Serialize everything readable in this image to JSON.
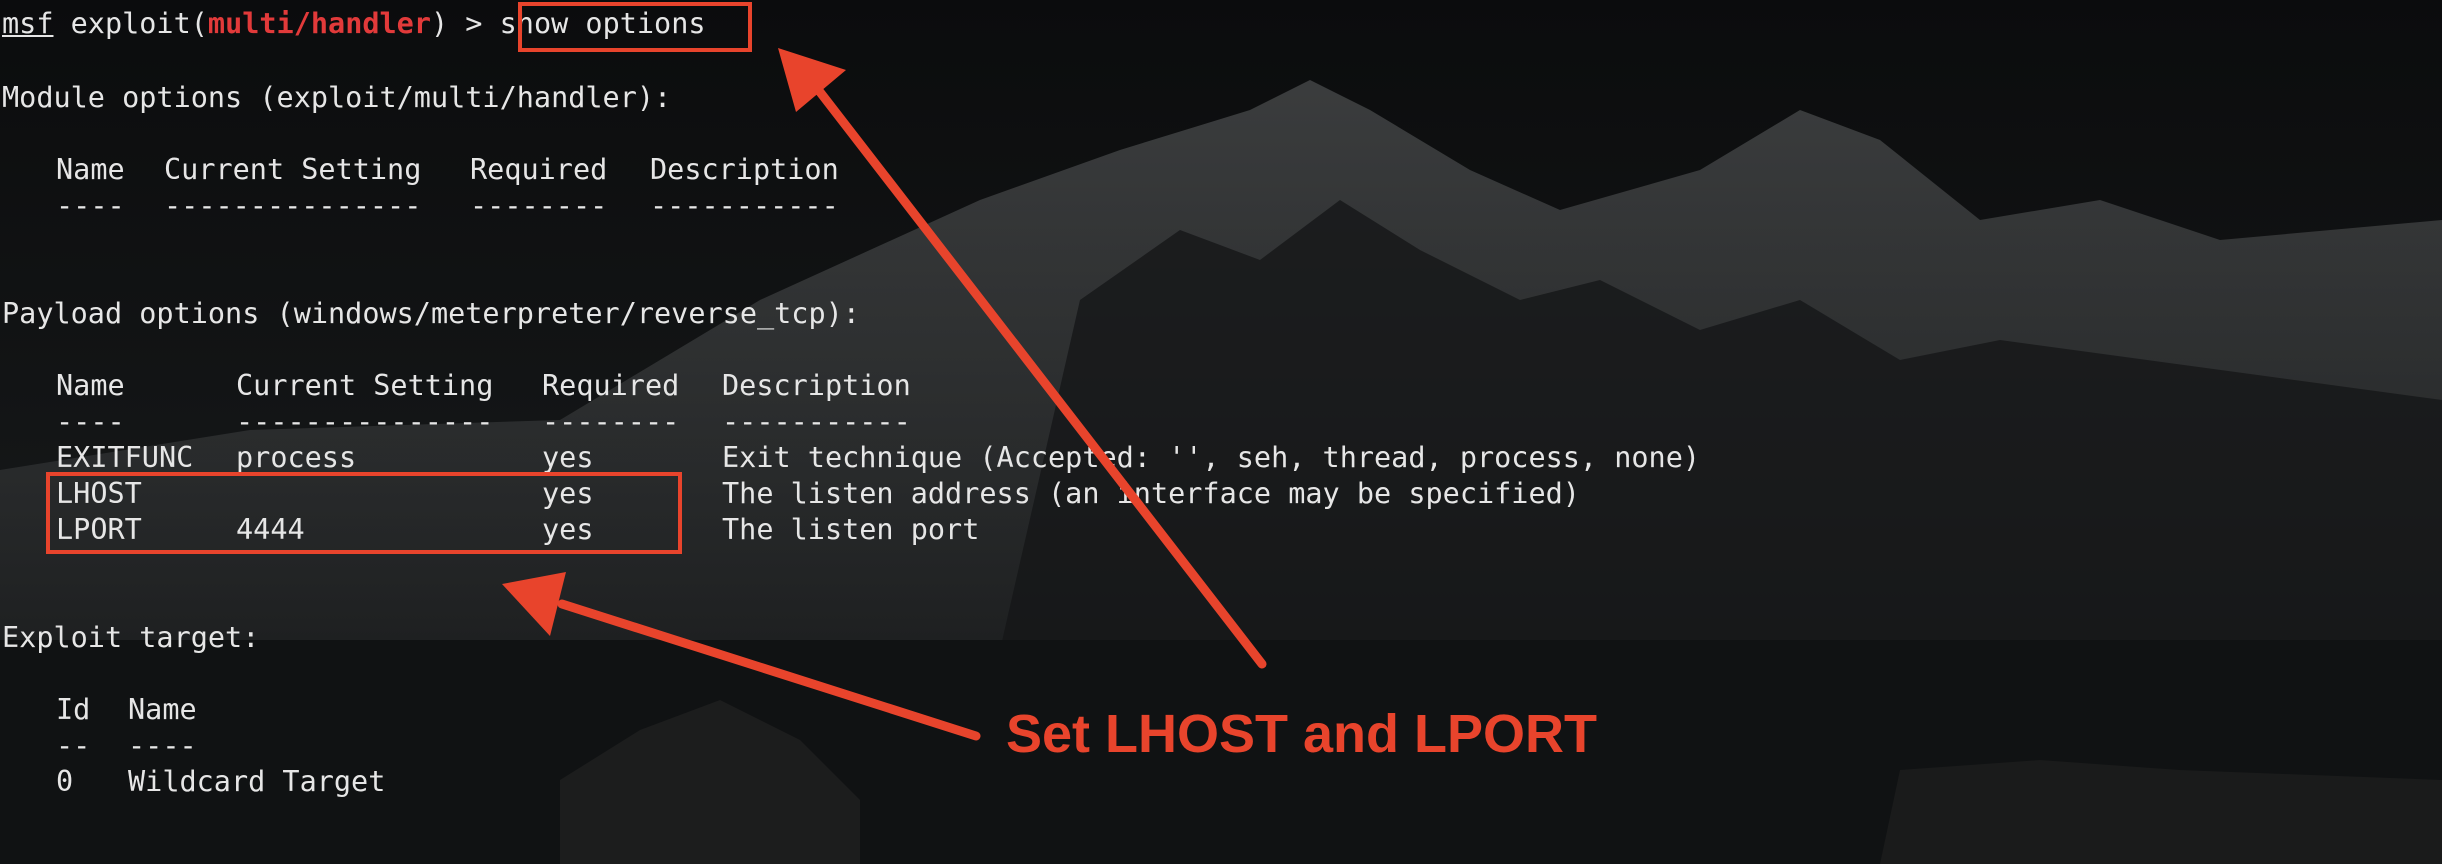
{
  "colors": {
    "background": "#0c0d0e",
    "terminal_text": "#e6e6e6",
    "module_name": "#e23a3a",
    "annotation": "#e8442c"
  },
  "prompt": {
    "msf": "msf",
    "exploit_prefix": " exploit(",
    "module": "multi/handler",
    "suffix": ") > ",
    "command": "show options"
  },
  "module_options": {
    "heading": "Module options (exploit/multi/handler):",
    "columns": [
      "Name",
      "Current Setting",
      "Required",
      "Description"
    ],
    "underlines": [
      "----",
      "---------------",
      "--------",
      "-----------"
    ]
  },
  "payload_options": {
    "heading": "Payload options (windows/meterpreter/reverse_tcp):",
    "columns": [
      "Name",
      "Current Setting",
      "Required",
      "Description"
    ],
    "underlines": [
      "----",
      "---------------",
      "--------",
      "-----------"
    ],
    "rows": [
      {
        "name": "EXITFUNC",
        "setting": "process",
        "required": "yes",
        "description": "Exit technique (Accepted: '', seh, thread, process, none)"
      },
      {
        "name": "LHOST",
        "setting": "",
        "required": "yes",
        "description": "The listen address (an interface may be specified)"
      },
      {
        "name": "LPORT",
        "setting": "4444",
        "required": "yes",
        "description": "The listen port"
      }
    ]
  },
  "exploit_target": {
    "heading": "Exploit target:",
    "columns": [
      "Id",
      "Name"
    ],
    "underlines": [
      "--",
      "----"
    ],
    "rows": [
      {
        "id": "0",
        "name": "Wildcard Target"
      }
    ]
  },
  "annotation": {
    "text": "Set LHOST and LPORT"
  }
}
